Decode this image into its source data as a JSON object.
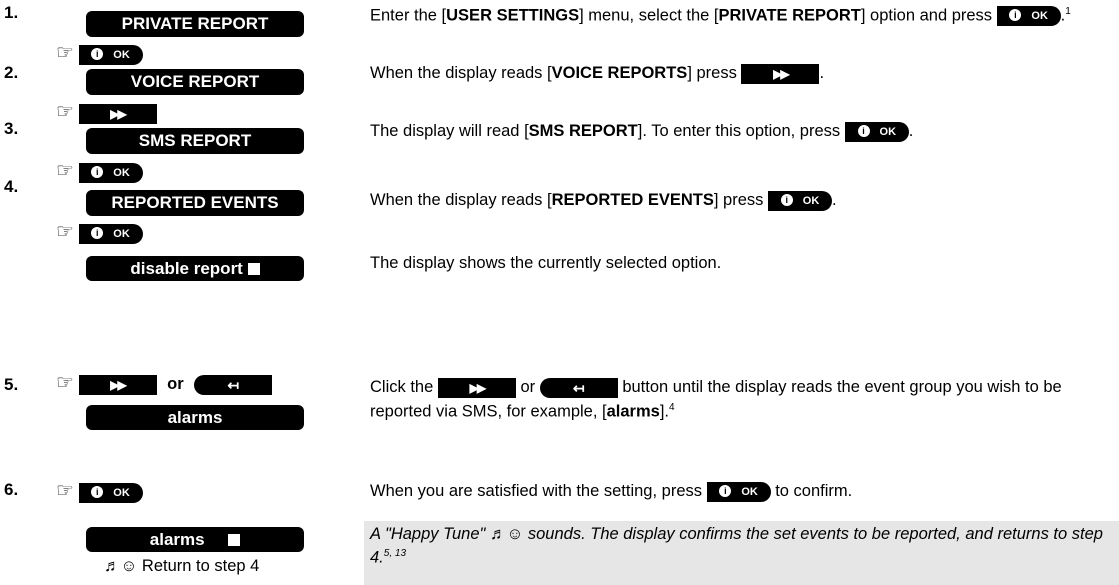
{
  "steps": [
    {
      "num": "1.",
      "display": "PRIVATE REPORT"
    },
    {
      "num": "2.",
      "display": "VOICE REPORT"
    },
    {
      "num": "3.",
      "display": "SMS REPORT"
    },
    {
      "num": "4.",
      "display": "REPORTED EVENTS"
    },
    {
      "num": "5.",
      "display": "alarms"
    },
    {
      "num": "6.",
      "display": "alarms"
    }
  ],
  "display_disable": "disable report",
  "ok_label": "OK",
  "info_glyph": "i",
  "fwd_glyph": "▶▶",
  "back_glyph": "↤",
  "hand_glyph": "☞",
  "or_text": "or",
  "return_text": "♬☺ Return to step 4",
  "desc": {
    "s1_a": "Enter the [",
    "s1_b": "USER SETTINGS",
    "s1_c": "] menu, select the [",
    "s1_d": "PRIVATE REPORT",
    "s1_e": "] option and press",
    "s1_fn": "1",
    "s2_a": "When the display reads [",
    "s2_b": "VOICE REPORTS",
    "s2_c": "] press",
    "s3_a": "The display will read [",
    "s3_b": "SMS REPORT",
    "s3_c": "]. To enter this option, press",
    "s4_a": "When the display reads [",
    "s4_b": "REPORTED EVENTS",
    "s4_c": "] press",
    "s4x": "The display shows the currently selected option.",
    "s5_a": "Click the",
    "s5_b": "or",
    "s5_c": "button until the display reads the event group you wish to be reported via SMS, for example, [",
    "s5_d": "alarms",
    "s5_e": "].",
    "s5_fn": "4",
    "s6_a": "When you are satisfied with the setting, press",
    "s6_b": "to confirm.",
    "note": "A \"Happy Tune\" ♬☺ sounds. The display confirms the set events to be reported, and returns to step 4.",
    "note_fn": "5, 13"
  }
}
